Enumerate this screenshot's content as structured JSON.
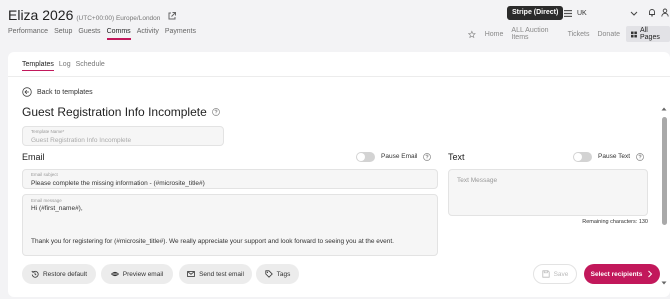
{
  "header": {
    "event_name": "Eliza 2026",
    "timezone": "(UTC+00:00) Europe/London",
    "stripe_badge": "Stripe (Direct)",
    "country": "UK"
  },
  "nav": {
    "tabs": [
      {
        "label": "Performance",
        "active": false
      },
      {
        "label": "Setup",
        "active": false
      },
      {
        "label": "Guests",
        "active": false
      },
      {
        "label": "Comms",
        "active": true
      },
      {
        "label": "Activity",
        "active": false
      },
      {
        "label": "Payments",
        "active": false
      }
    ],
    "links": [
      "Home",
      "ALL Auction Items",
      "Tickets",
      "Donate"
    ],
    "all_pages": "All Pages"
  },
  "subtabs": [
    {
      "label": "Templates",
      "active": true
    },
    {
      "label": "Log",
      "active": false
    },
    {
      "label": "Schedule",
      "active": false
    }
  ],
  "back_label": "Back to templates",
  "page_title": "Guest Registration Info Incomplete",
  "template_name": {
    "label": "Template Name*",
    "placeholder": "Guest Registration Info Incomplete"
  },
  "email": {
    "heading": "Email",
    "pause_label": "Pause Email",
    "subject_label": "Email subject",
    "subject_value": "Please complete the missing information - (#microsite_title#)",
    "message_label": "Email message",
    "message_line1": "Hi (#first_name#),",
    "message_line2": "Thank you for registering for (#microsite_title#). We really appreciate your support and look forward to seeing you at the event."
  },
  "text": {
    "heading": "Text",
    "pause_label": "Pause Text",
    "placeholder": "Text Message",
    "remaining": "Remaining characters: 130"
  },
  "actions": {
    "restore": "Restore default",
    "preview": "Preview email",
    "send_test": "Send test email",
    "tags": "Tags",
    "save": "Save",
    "select_recipients": "Select recipients"
  },
  "colors": {
    "accent": "#c2185b",
    "badge_bg": "#2b2b2b",
    "background": "#f3f3f5"
  }
}
